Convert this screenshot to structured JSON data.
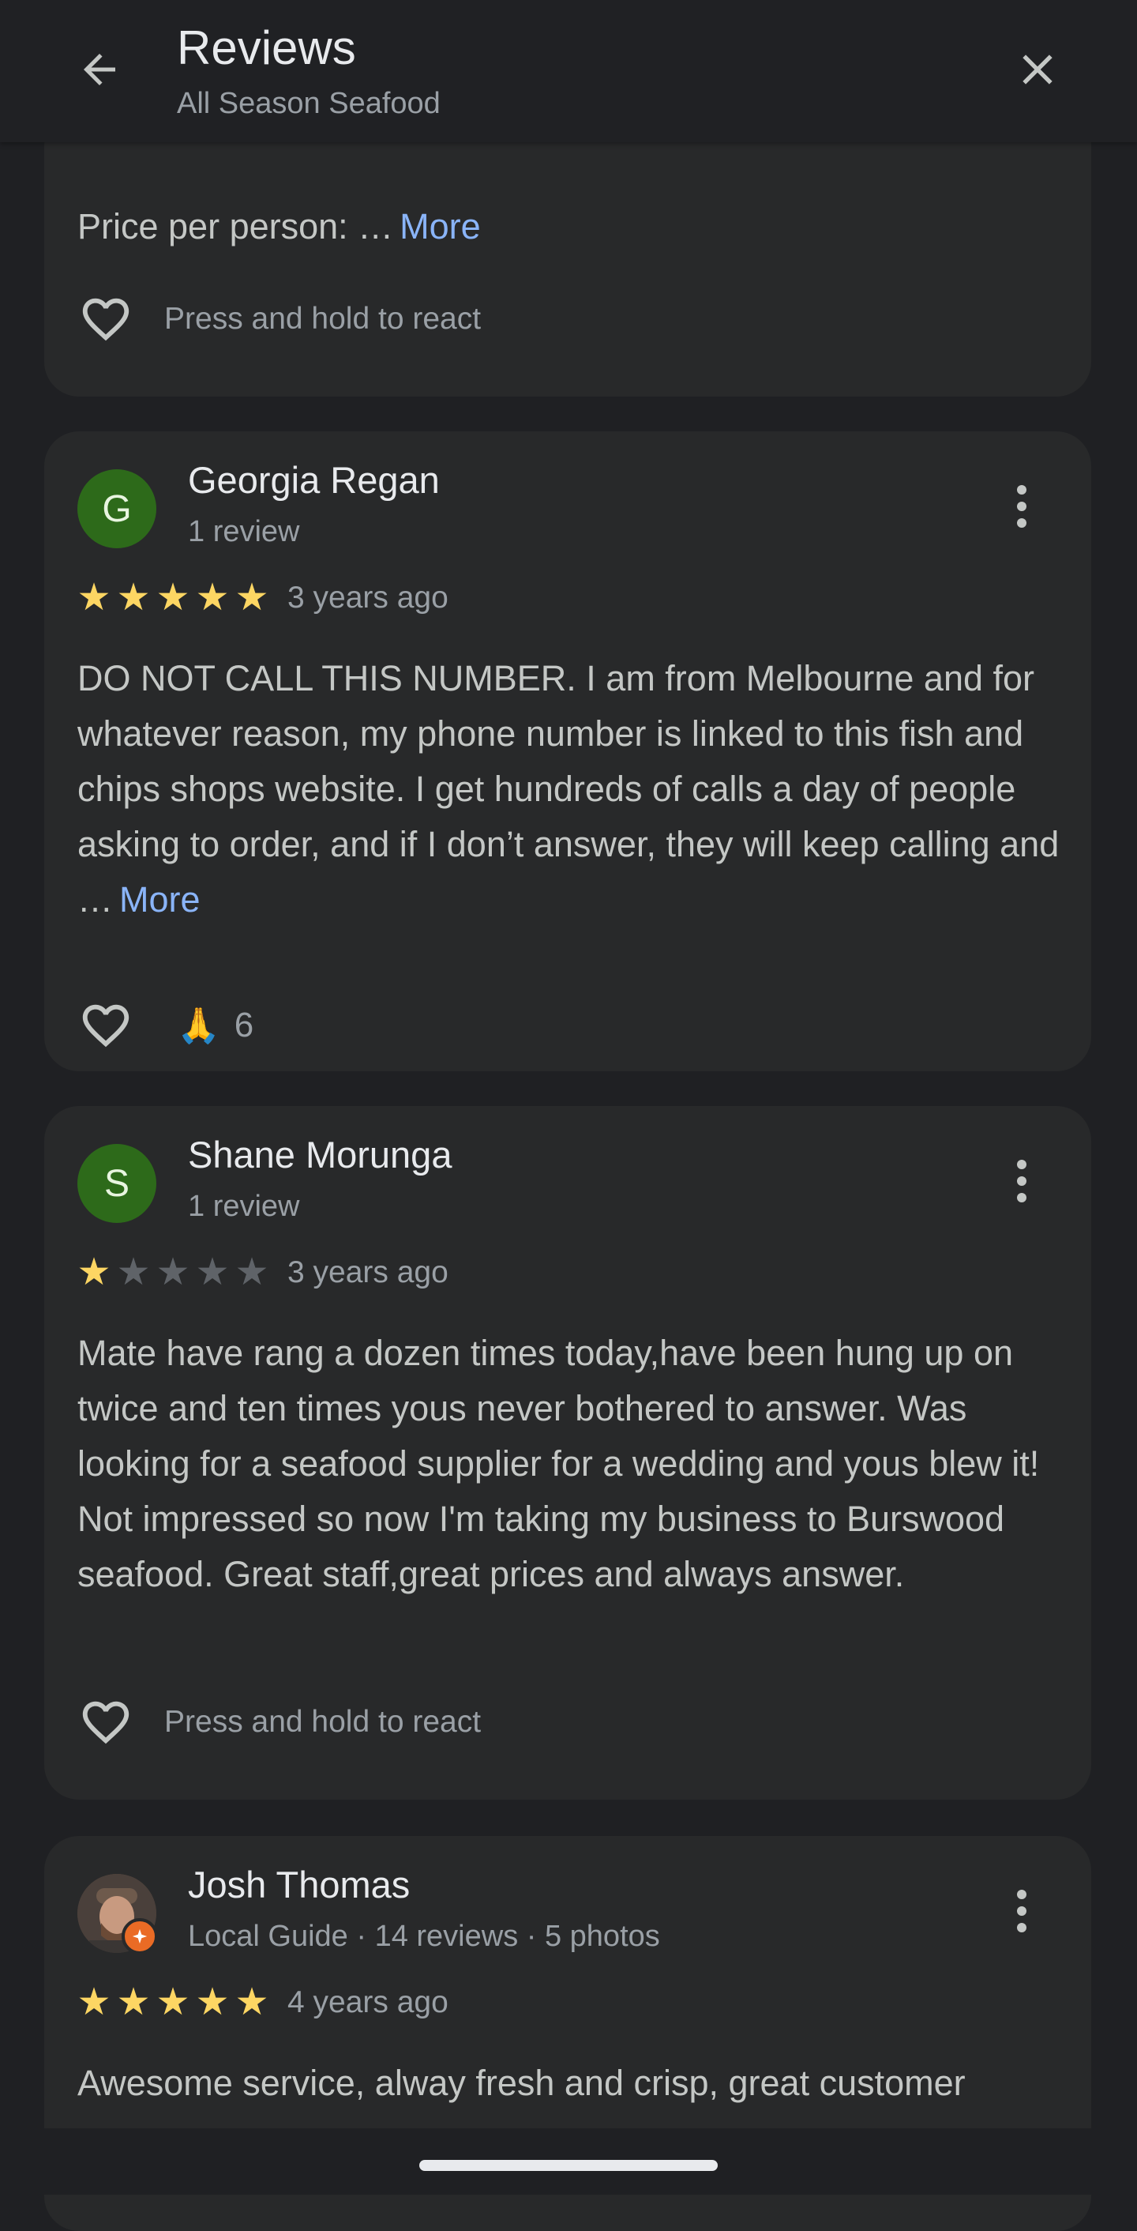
{
  "header": {
    "title": "Reviews",
    "subtitle": "All Season Seafood",
    "back_icon": "arrow-back-icon",
    "close_icon": "close-icon"
  },
  "partial_review": {
    "text": "Price per person: …",
    "more_label": "More",
    "react_hint": "Press and hold to react"
  },
  "reviews": [
    {
      "initial": "G",
      "name": "Georgia Regan",
      "meta": "1 review",
      "rating": 5,
      "date": "3 years ago",
      "text": "DO NOT CALL THIS NUMBER. I am from Melbourne and for whatever reason, my phone number is linked to this fish and chips shops website. I get hundreds of calls a day of people asking to order, and if I don’t answer, they will keep calling and …",
      "more_label": "More",
      "reaction_emoji": "🙏",
      "reaction_count": "6"
    },
    {
      "initial": "S",
      "name": "Shane Morunga",
      "meta": "1 review",
      "rating": 1,
      "date": "3 years ago",
      "text": "Mate have rang a dozen times today,have been hung up on twice and ten times yous never bothered to answer. Was looking for a seafood supplier for a wedding and yous blew it! Not impressed so now I'm taking my business to Burswood seafood. Great staff,great prices and always answer.",
      "react_hint": "Press and hold to react"
    },
    {
      "name": "Josh Thomas",
      "meta": "Local Guide · 14 reviews · 5 photos",
      "rating": 5,
      "date": "4 years ago",
      "text": "Awesome service, alway fresh and crisp, great customer"
    }
  ],
  "colors": {
    "background": "#1f2023",
    "card": "#28292a",
    "star_on": "#fdd663",
    "link": "#8ab4f8",
    "avatar_green": "#2d6a1a",
    "local_guide_badge": "#ea6b25"
  }
}
